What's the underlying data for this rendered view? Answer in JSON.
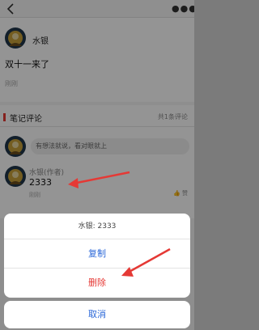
{
  "post": {
    "author": "水银",
    "text": "双十一来了",
    "time": "刚刚"
  },
  "comments_section": {
    "title": "笔记评论",
    "count": "共1条评论",
    "input_placeholder": "有想法就说，看对眼就上",
    "comment": {
      "author": "水银(作者)",
      "text": "2333",
      "time": "刚刚",
      "like_label": "赞"
    }
  },
  "action_sheet": {
    "title": "水银: 2333",
    "copy_label": "复制",
    "delete_label": "删除",
    "cancel_label": "取消"
  },
  "colors": {
    "accent_red": "#e53935",
    "ios_blue": "#2a67d8"
  },
  "icons": {
    "back": "chevron-left-icon",
    "more": "more-dots-icon",
    "like": "thumb-up-icon"
  }
}
